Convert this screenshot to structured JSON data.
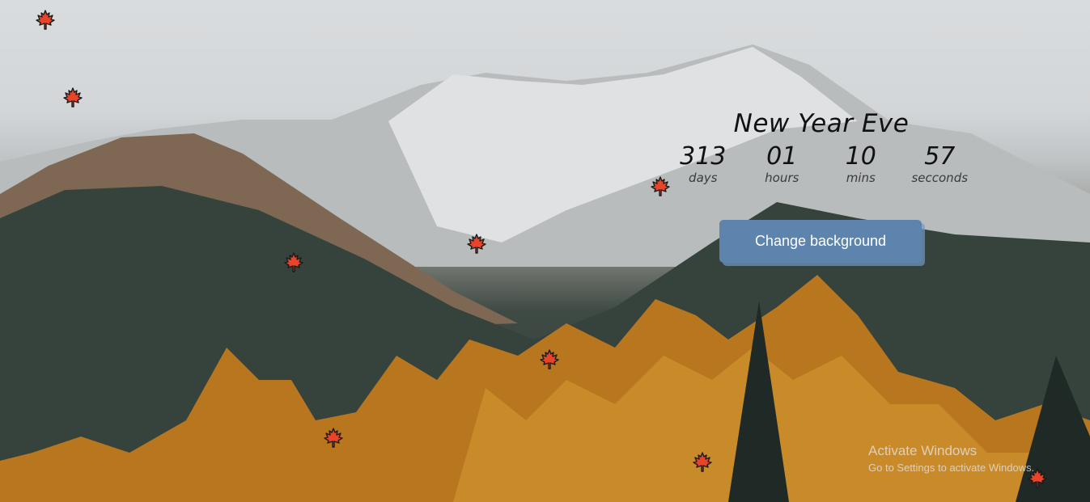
{
  "countdown": {
    "title": "New Year Eve",
    "units": [
      {
        "value": "313",
        "label": "days"
      },
      {
        "value": "01",
        "label": "hours"
      },
      {
        "value": "10",
        "label": "mins"
      },
      {
        "value": "57",
        "label": "secconds"
      }
    ]
  },
  "button": {
    "label": "Change background"
  },
  "activate_windows": {
    "title": "Activate Windows",
    "subtitle": "Go to Settings to activate Windows."
  },
  "colors": {
    "button": "#5d84ad",
    "leaf": "#e8442a",
    "leaf_outline": "#1a1a1a"
  },
  "leaf_icon": "maple-leaf-icon"
}
